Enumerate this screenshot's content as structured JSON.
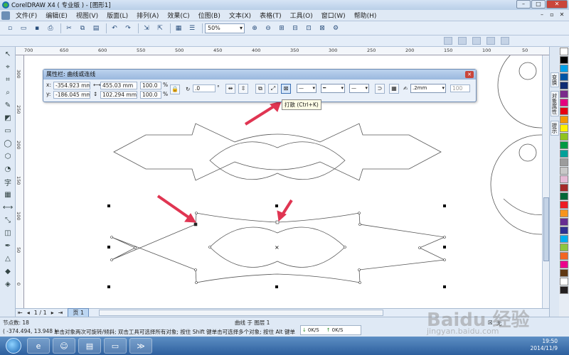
{
  "window": {
    "title": "CorelDRAW X4 ( 专业版 ) - [图形1]",
    "controls": [
      "–",
      "□",
      "✕"
    ]
  },
  "menu": {
    "items": [
      "文件(F)",
      "编辑(E)",
      "视图(V)",
      "版面(L)",
      "排列(A)",
      "效果(C)",
      "位图(B)",
      "文本(X)",
      "表格(T)",
      "工具(O)",
      "窗口(W)",
      "帮助(H)"
    ],
    "controls": [
      "–",
      "▫",
      "✕"
    ]
  },
  "toolbar": {
    "zoom": "50%"
  },
  "ruler_top": {
    "labels": [
      "700",
      "650",
      "600",
      "550",
      "500",
      "450",
      "400",
      "350",
      "300",
      "250",
      "200",
      "150",
      "100",
      "50"
    ]
  },
  "ruler_left": {
    "labels": [
      "300",
      "250",
      "200",
      "150",
      "100",
      "50",
      "0",
      "250"
    ]
  },
  "dialog": {
    "title": "属性栏: 曲线或连线",
    "x_label": "x:",
    "x_value": "-354.923 mm",
    "y_label": "y:",
    "y_value": "-186.045 mm",
    "w_value": "455.03 mm",
    "h_value": "102.294 mm",
    "scale_x": "100.0",
    "scale_y": "100.0",
    "pct": "%",
    "angle": ".0",
    "deg": "°",
    "outline_width": ".2mm",
    "number": "100"
  },
  "tooltip": {
    "text": "打散 (Ctrl+K)"
  },
  "docker": {
    "tabs": [
      "变换",
      "对象属性",
      "提示"
    ]
  },
  "palette": {
    "colors": [
      "#ffffff",
      "#000000",
      "#00a0e9",
      "#0055a5",
      "#0f2c73",
      "#7a2b8b",
      "#e4007f",
      "#e60012",
      "#f39800",
      "#fff100",
      "#8fc31f",
      "#009944",
      "#00a199",
      "#9c9c9c",
      "#c8c8c8",
      "#e5b9d5",
      "#a52a2a",
      "#006837",
      "#ed1c24",
      "#f7941d",
      "#662d91",
      "#2e3192",
      "#00aeef",
      "#8dc63f",
      "#f26522",
      "#ec008c",
      "#603913",
      "#ffffff",
      "#231f20"
    ]
  },
  "pagebar": {
    "counter": "1 / 1",
    "tab": "页 1"
  },
  "status": {
    "nodes": "节点数: 18",
    "layer": "曲线 于 图层 1",
    "coords": "( -374.494, 13.948 )",
    "hint": "单击对象两次可旋转/倾斜; 双击工具可选择所有对象; 按住 Shift 键单击可选择多个对象; 按住 Alt 键单",
    "fill": "无",
    "net_down": "0K/S",
    "net_up": "0K/S"
  },
  "taskbar": {
    "time": "19:50",
    "date": "2014/11/9",
    "apps": [
      "IE",
      "QQ",
      "文件夹",
      "窗口",
      "CorelDRAW"
    ]
  },
  "watermark": {
    "text": "Baidu 经验",
    "url": "jingyan.baidu.com"
  }
}
